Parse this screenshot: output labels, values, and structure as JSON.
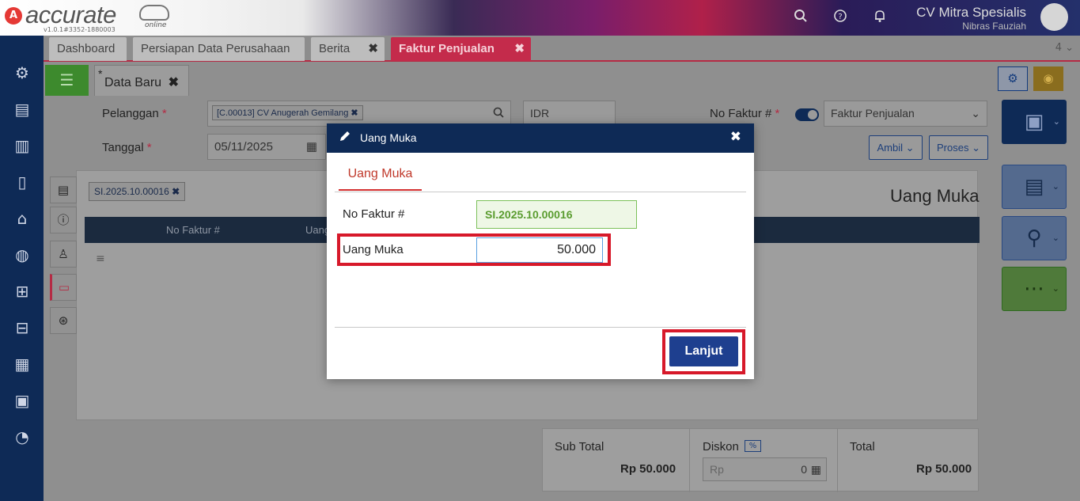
{
  "app": {
    "logo_letter": "A",
    "logo_name": "accurate",
    "logo_suffix": "online",
    "version": "v1.0.1#3352-1880003",
    "company_name": "CV Mitra Spesialis",
    "user_name": "Nibras Fauziah"
  },
  "tabs": [
    {
      "label": "Dashboard"
    },
    {
      "label": "Persiapan Data Perusahaan"
    },
    {
      "label": "Berita",
      "close": "✖"
    },
    {
      "label": "Faktur Penjualan",
      "close": "✖",
      "active": true
    }
  ],
  "tab_count": "4 ⌄",
  "doc_tab": {
    "star": "*",
    "label": "Data Baru",
    "close": "✖"
  },
  "form": {
    "pelanggan_label": "Pelanggan",
    "pelanggan_value": "[C.00013] CV Anugerah Gemilang",
    "currency": "IDR",
    "tanggal_label": "Tanggal",
    "tanggal_value": "05/11/2025",
    "no_faktur_label": "No Faktur #",
    "required_mark": "*",
    "faktur_type": "Faktur Penjualan",
    "ambil_label": "Ambil",
    "proses_label": "Proses",
    "invoice_chip": "SI.2025.10.00016",
    "col_no_faktur": "No Faktur #",
    "col_uang": "Uang",
    "section_title": "Uang Muka",
    "hamburger": "≡"
  },
  "totals": {
    "subtotal_label": "Sub Total",
    "subtotal_value": "Rp 50.000",
    "diskon_label": "Diskon",
    "diskon_unit": "%",
    "diskon_prefix": "Rp",
    "diskon_value": "0",
    "total_label": "Total",
    "total_value": "Rp 50.000"
  },
  "modal": {
    "title": "Uang Muka",
    "tab_label": "Uang Muka",
    "no_faktur_label": "No Faktur #",
    "no_faktur_value": "SI.2025.10.00016",
    "uang_muka_label": "Uang Muka",
    "uang_muka_value": "50.000",
    "submit_label": "Lanjut",
    "close": "✖"
  },
  "colors": {
    "sidebar": "#0e2a56",
    "active_tab": "#c42b4b",
    "highlight": "#d7192a",
    "primary_button": "#1e3f8f"
  }
}
